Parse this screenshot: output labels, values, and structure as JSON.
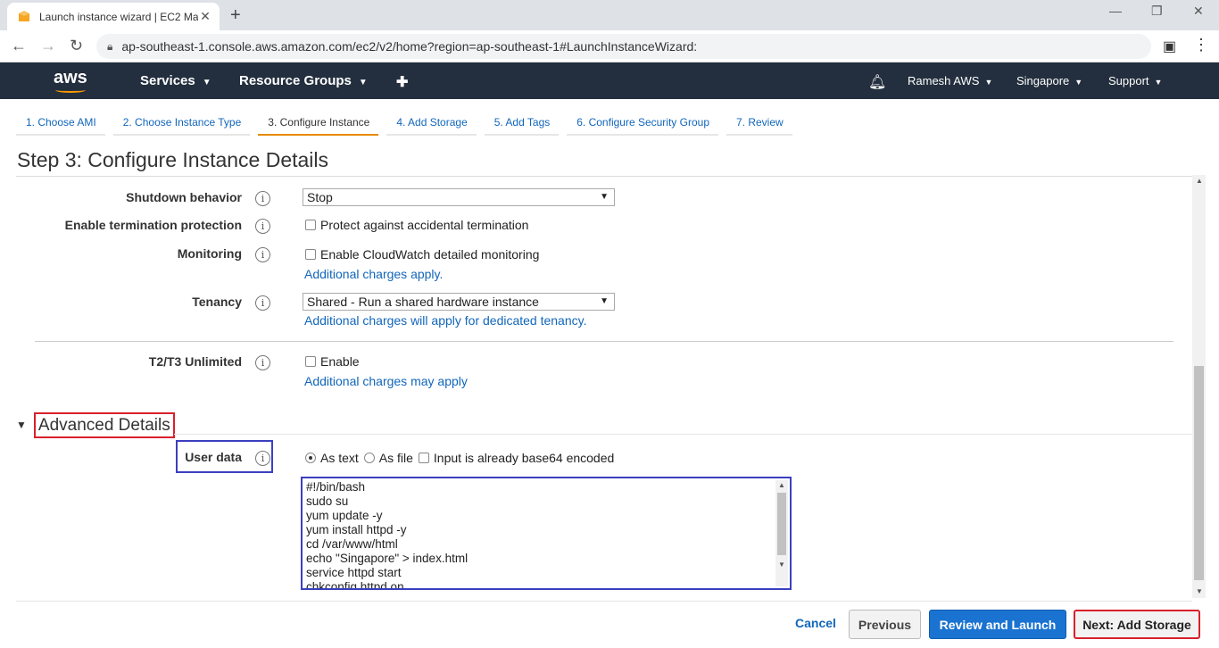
{
  "browser": {
    "tab_title": "Launch instance wizard | EC2 Ma",
    "url": "ap-southeast-1.console.aws.amazon.com/ec2/v2/home?region=ap-southeast-1#LaunchInstanceWizard:"
  },
  "aws_header": {
    "logo": "aws",
    "services": "Services",
    "resource_groups": "Resource Groups",
    "user": "Ramesh AWS",
    "region": "Singapore",
    "support": "Support"
  },
  "wizard_tabs": [
    "1. Choose AMI",
    "2. Choose Instance Type",
    "3. Configure Instance",
    "4. Add Storage",
    "5. Add Tags",
    "6. Configure Security Group",
    "7. Review"
  ],
  "active_tab_index": 2,
  "step_title": "Step 3: Configure Instance Details",
  "form": {
    "shutdown": {
      "label": "Shutdown behavior",
      "value": "Stop"
    },
    "termination": {
      "label": "Enable termination protection",
      "checkbox": "Protect against accidental termination"
    },
    "monitoring": {
      "label": "Monitoring",
      "checkbox": "Enable CloudWatch detailed monitoring",
      "note": "Additional charges apply."
    },
    "tenancy": {
      "label": "Tenancy",
      "value": "Shared - Run a shared hardware instance",
      "note": "Additional charges will apply for dedicated tenancy."
    },
    "t2t3": {
      "label": "T2/T3 Unlimited",
      "checkbox": "Enable",
      "note": "Additional charges may apply"
    }
  },
  "advanced": {
    "title": "Advanced Details",
    "user_data_label": "User data",
    "as_text": "As text",
    "as_file": "As file",
    "base64": "Input is already base64 encoded",
    "script": "#!/bin/bash\nsudo su\nyum update -y\nyum install httpd -y\ncd /var/www/html\necho \"Singapore\" > index.html\nservice httpd start\nchkconfig httpd on"
  },
  "buttons": {
    "cancel": "Cancel",
    "previous": "Previous",
    "review": "Review and Launch",
    "next": "Next: Add Storage"
  },
  "colors": {
    "aws_nav": "#232f3e",
    "link": "#1166bb",
    "primary": "#1a73d1",
    "highlight_red": "#d9202c",
    "highlight_blue": "#3b3fbf",
    "active_tab": "#e68a00"
  }
}
